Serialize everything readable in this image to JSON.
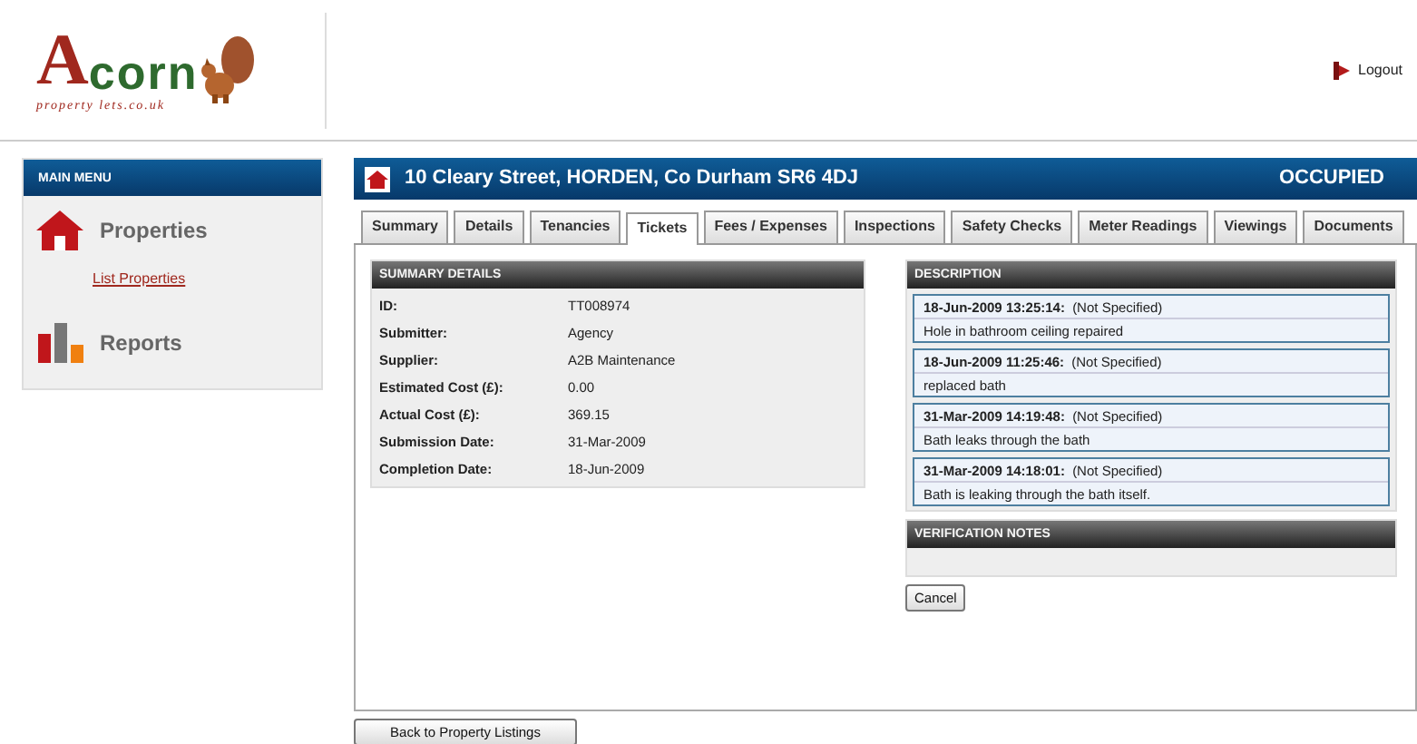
{
  "logo": {
    "initial": "A",
    "rest": "corn",
    "tagline": "property lets.co.uk"
  },
  "header": {
    "logout": "Logout"
  },
  "sidebar": {
    "title": "MAIN MENU",
    "sections": [
      {
        "kind": "properties",
        "label": "Properties",
        "links": [
          "List Properties"
        ]
      },
      {
        "kind": "reports",
        "label": "Reports"
      }
    ]
  },
  "property": {
    "address": "10 Cleary Street, HORDEN, Co Durham SR6 4DJ",
    "status": "OCCUPIED"
  },
  "tabs": [
    {
      "label": "Summary",
      "selected": false
    },
    {
      "label": "Details",
      "selected": false
    },
    {
      "label": "Tenancies",
      "selected": false
    },
    {
      "label": "Tickets",
      "selected": true
    },
    {
      "label": "Fees / Expenses",
      "selected": false
    },
    {
      "label": "Inspections",
      "selected": false
    },
    {
      "label": "Safety Checks",
      "selected": false
    },
    {
      "label": "Meter Readings",
      "selected": false
    },
    {
      "label": "Viewings",
      "selected": false
    },
    {
      "label": "Documents",
      "selected": false
    }
  ],
  "summary": {
    "title": "SUMMARY DETAILS",
    "rows": [
      {
        "label": "ID:",
        "value": "TT008974"
      },
      {
        "label": "Submitter:",
        "value": "Agency"
      },
      {
        "label": "Supplier:",
        "value": "A2B Maintenance"
      },
      {
        "label": "Estimated Cost (£):",
        "value": "0.00"
      },
      {
        "label": "Actual Cost (£):",
        "value": "369.15"
      },
      {
        "label": "Submission Date:",
        "value": "31-Mar-2009"
      },
      {
        "label": "Completion Date:",
        "value": "18-Jun-2009"
      }
    ]
  },
  "description": {
    "title": "DESCRIPTION",
    "entries": [
      {
        "timestamp": "18-Jun-2009 13:25:14:",
        "author": "(Not Specified)",
        "text": "Hole in bathroom ceiling repaired"
      },
      {
        "timestamp": "18-Jun-2009 11:25:46:",
        "author": "(Not Specified)",
        "text": "replaced bath"
      },
      {
        "timestamp": "31-Mar-2009 14:19:48:",
        "author": "(Not Specified)",
        "text": "Bath leaks through the bath"
      },
      {
        "timestamp": "31-Mar-2009 14:18:01:",
        "author": "(Not Specified)",
        "text": "Bath is leaking through the bath itself."
      }
    ]
  },
  "verification": {
    "title": "VERIFICATION NOTES"
  },
  "buttons": {
    "cancel": "Cancel",
    "back": "Back to Property Listings"
  }
}
